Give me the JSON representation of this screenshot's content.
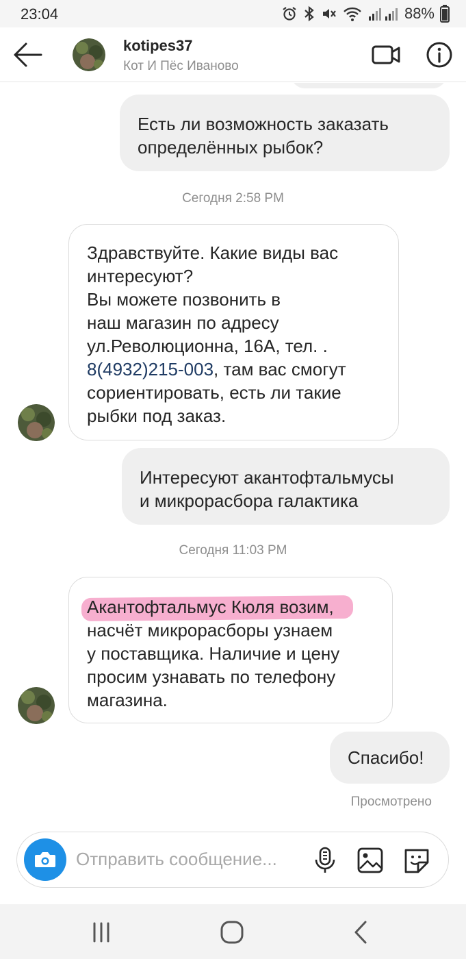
{
  "status_bar": {
    "time": "23:04",
    "battery": "88%",
    "icons": [
      "alarm-icon",
      "bluetooth-icon",
      "mute-icon",
      "wifi-icon",
      "signal-icon",
      "battery-icon"
    ]
  },
  "header": {
    "username": "kotipes37",
    "subtitle": "Кот И Пёс Иваново",
    "icons": [
      "back-arrow-icon",
      "video-call-icon",
      "info-icon"
    ]
  },
  "messages": [
    {
      "side": "out",
      "text": "Есть ли возможность заказать\nопределённых рыбок?"
    },
    {
      "side": "stamp",
      "text": "Сегодня 2:58 PM"
    },
    {
      "side": "in",
      "text_before": "Здравствуйте. Какие виды вас\nинтересуют?\nВы можете позвонить в\nнаш магазин по адресу\nул.Революционна, 16А, тел. .\n",
      "phone": "8(4932)215-003",
      "text_after": ", там вас смогут\nсориентировать, есть ли такие\nрыбки под заказ."
    },
    {
      "side": "out",
      "text": "Интересуют акантофтальмусы\nи микрорасбора галактика"
    },
    {
      "side": "stamp",
      "text": "Сегодня 11:03 PM"
    },
    {
      "side": "in",
      "highlight": "Акантофтальмус Кюля возим,",
      "text_after": "\nнасчёт микрорасборы узнаем\nу поставщика. Наличие и цену\nпросим узнавать по телефону\nмагазина."
    },
    {
      "side": "out",
      "text": "Спасибо!"
    }
  ],
  "seen_label": "Просмотрено",
  "composer": {
    "placeholder": "Отправить сообщение...",
    "icons": [
      "camera-icon",
      "microphone-icon",
      "gallery-icon",
      "sticker-icon"
    ]
  },
  "nav_bar": {
    "icons": [
      "recent-apps-icon",
      "home-icon",
      "back-icon"
    ]
  },
  "colors": {
    "accent_blue": "#1e90e6",
    "outgoing_bubble": "#efefef",
    "phone_link": "#1f3b63",
    "highlight_pink": "#ec408c",
    "muted_text": "#8e8e8e"
  }
}
